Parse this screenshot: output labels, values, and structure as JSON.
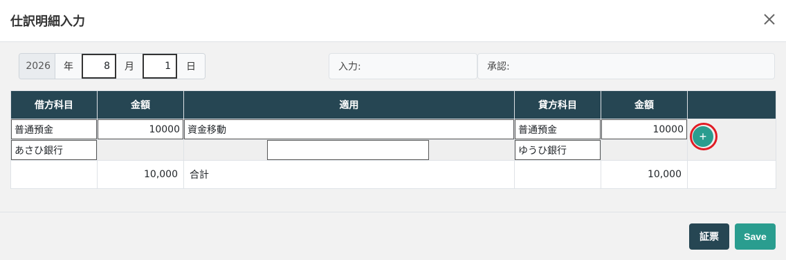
{
  "dialog": {
    "title": "仕訳明細入力"
  },
  "date": {
    "year": "2026",
    "year_unit": "年",
    "month": "8",
    "month_unit": "月",
    "day": "1",
    "day_unit": "日"
  },
  "stamps": {
    "input_label": "入力:",
    "approve_label": "承認:"
  },
  "table": {
    "headers": [
      "借方科目",
      "金額",
      "適用",
      "貸方科目",
      "金額",
      ""
    ],
    "row1": {
      "debit_account": "普通預金",
      "debit_amount": "10000",
      "description": "資金移動",
      "credit_account": "普通預金",
      "credit_amount": "10000"
    },
    "row2": {
      "debit_sub": "あさひ銀行",
      "description_extra": "",
      "credit_sub": "ゆうひ銀行"
    },
    "total": {
      "debit_total": "10,000",
      "label": "合計",
      "credit_total": "10,000"
    }
  },
  "actions": {
    "add_label": "+",
    "voucher_label": "証票",
    "save_label": "Save"
  },
  "colors": {
    "header_bg": "#264653",
    "accent": "#2a9d8f",
    "highlight_ring": "#e01b24"
  }
}
